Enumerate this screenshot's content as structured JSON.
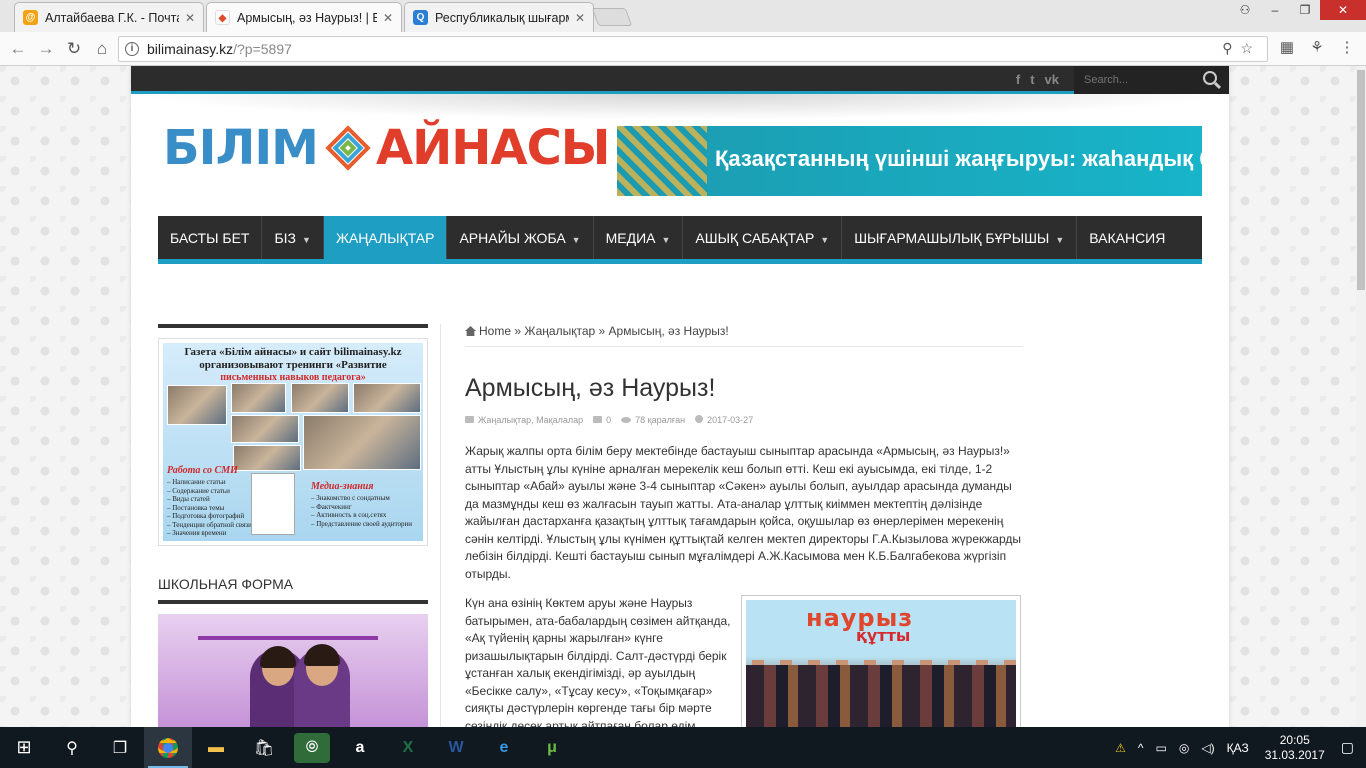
{
  "browser": {
    "tabs": [
      {
        "title": "Алтайбаева Г.К. - Почта",
        "fav_color": "#f2a30f",
        "fav_glyph": "@"
      },
      {
        "title": "Армысың, әз Наурыз! | Б",
        "fav_color": "#e04a2a",
        "fav_glyph": "◆"
      },
      {
        "title": "Республикалық шығарм",
        "fav_color": "#2a7fd4",
        "fav_glyph": "Q"
      }
    ],
    "url_host": "bilimainasy.kz",
    "url_path": "/?p=5897"
  },
  "site": {
    "logo_left": "БІЛІМ",
    "logo_right": "АЙНАСЫ",
    "banner_text": "Қазақстанның үшінші жаңғыруы: жаһандық бәсекеге қабілеттілік",
    "search_placeholder": "Search...",
    "social": [
      "f",
      "t",
      "vk"
    ],
    "menu": [
      {
        "label": "БАСТЫ БЕТ",
        "caret": false,
        "active": false
      },
      {
        "label": "БІЗ",
        "caret": true,
        "active": false
      },
      {
        "label": "ЖАҢАЛЫҚТАР",
        "caret": false,
        "active": true
      },
      {
        "label": "АРНАЙЫ ЖОБА",
        "caret": true,
        "active": false
      },
      {
        "label": "МЕДИА",
        "caret": true,
        "active": false
      },
      {
        "label": "АШЫҚ САБАҚТАР",
        "caret": true,
        "active": false
      },
      {
        "label": "ШЫҒАРМАШЫЛЫҚ БҰРЫШЫ",
        "caret": true,
        "active": false
      },
      {
        "label": "ВАКАНСИЯ",
        "caret": false,
        "active": false
      }
    ]
  },
  "sidebar": {
    "ad1_heading": "Газета «Білім айнасы» и сайт bilimainasy.kz организовывают тренинги «Развитие",
    "ad1_sub": "письменных навыков педагога»",
    "ad1_left_red": "Работа со СМИ",
    "ad1_right_red": "Медиа-знания",
    "ad1_list_left": "– Написание статьи\n– Содержание статьи\n– Виды статей\n– Постановка темы\n– Подготовка фотографий\n– Тенденции обратной связи\n– Значения времени",
    "ad1_list_right": "– Знакомство с сондатным\n– Фактчекинг\n– Активность в соц.сетях\n– Представление своей аудитории",
    "section_title": "ШКОЛЬНАЯ ФОРМА"
  },
  "article": {
    "crumb_home": "Home",
    "crumb_sep": "»",
    "crumb_cat": "Жаңалықтар",
    "crumb_current": "Армысың, әз Наурыз!",
    "title": "Армысың, әз Наурыз!",
    "meta_cats": "Жаңалықтар, Мақалалар",
    "meta_comments": "0",
    "meta_views": "78 қаралған",
    "meta_date": "2017-03-27",
    "para1": "Жарық жалпы орта білім беру мектебінде бастауыш сыныптар арасында «Армысың, әз Наурыз!» атты Ұлыстың ұлы күніне арналған мерекелік кеш болып өтті. Кеш екі ауысымда, екі тілде, 1-2 сыныптар «Абай» ауылы және 3-4 сыныптар «Сәкен» ауылы болып, ауылдар арасында думанды да мазмұнды кеш өз жалғасын тауып жатты. Ата-аналар ұлттық киіммен  мектептің дәлізінде жайылған дастарханға қазақтың ұлттық тағамдарын қойса,  оқушылар өз өнерлерімен мерекенің сәнін келтірді. Ұлыстың ұлы күнімен құттықтай келген мектеп директоры Г.А.Кызылова жүрекжарды лебізін білдірді. Кешті бастауыш сынып мұғалімдері А.Ж.Касымова мен К.Б.Балгабекова жүргізіп отырды.",
    "para2": "Күн ана өзінің Көктем аруы және Наурыз батырымен, ата-бабалардың сөзімен айтқанда, «Ақ түйенің қарны жарылған» күнге ризашылықтарын білдірді. Салт-дәстүрді берік ұстанған халық екендігімізді, әр ауылдың «Бесікке салу», «Тұсау кесу», «Тоқымқағар» сияқты дәстүрлерін көргенде тағы бір мәрте сезіндік десек артық айтпаған болар едім. Ертеден ұмытылып калғандай болған",
    "photo_word1": "наурыз",
    "photo_word2": "құтты"
  },
  "taskbar": {
    "lang": "ҚАЗ",
    "time": "20:05",
    "date": "31.03.2017"
  }
}
